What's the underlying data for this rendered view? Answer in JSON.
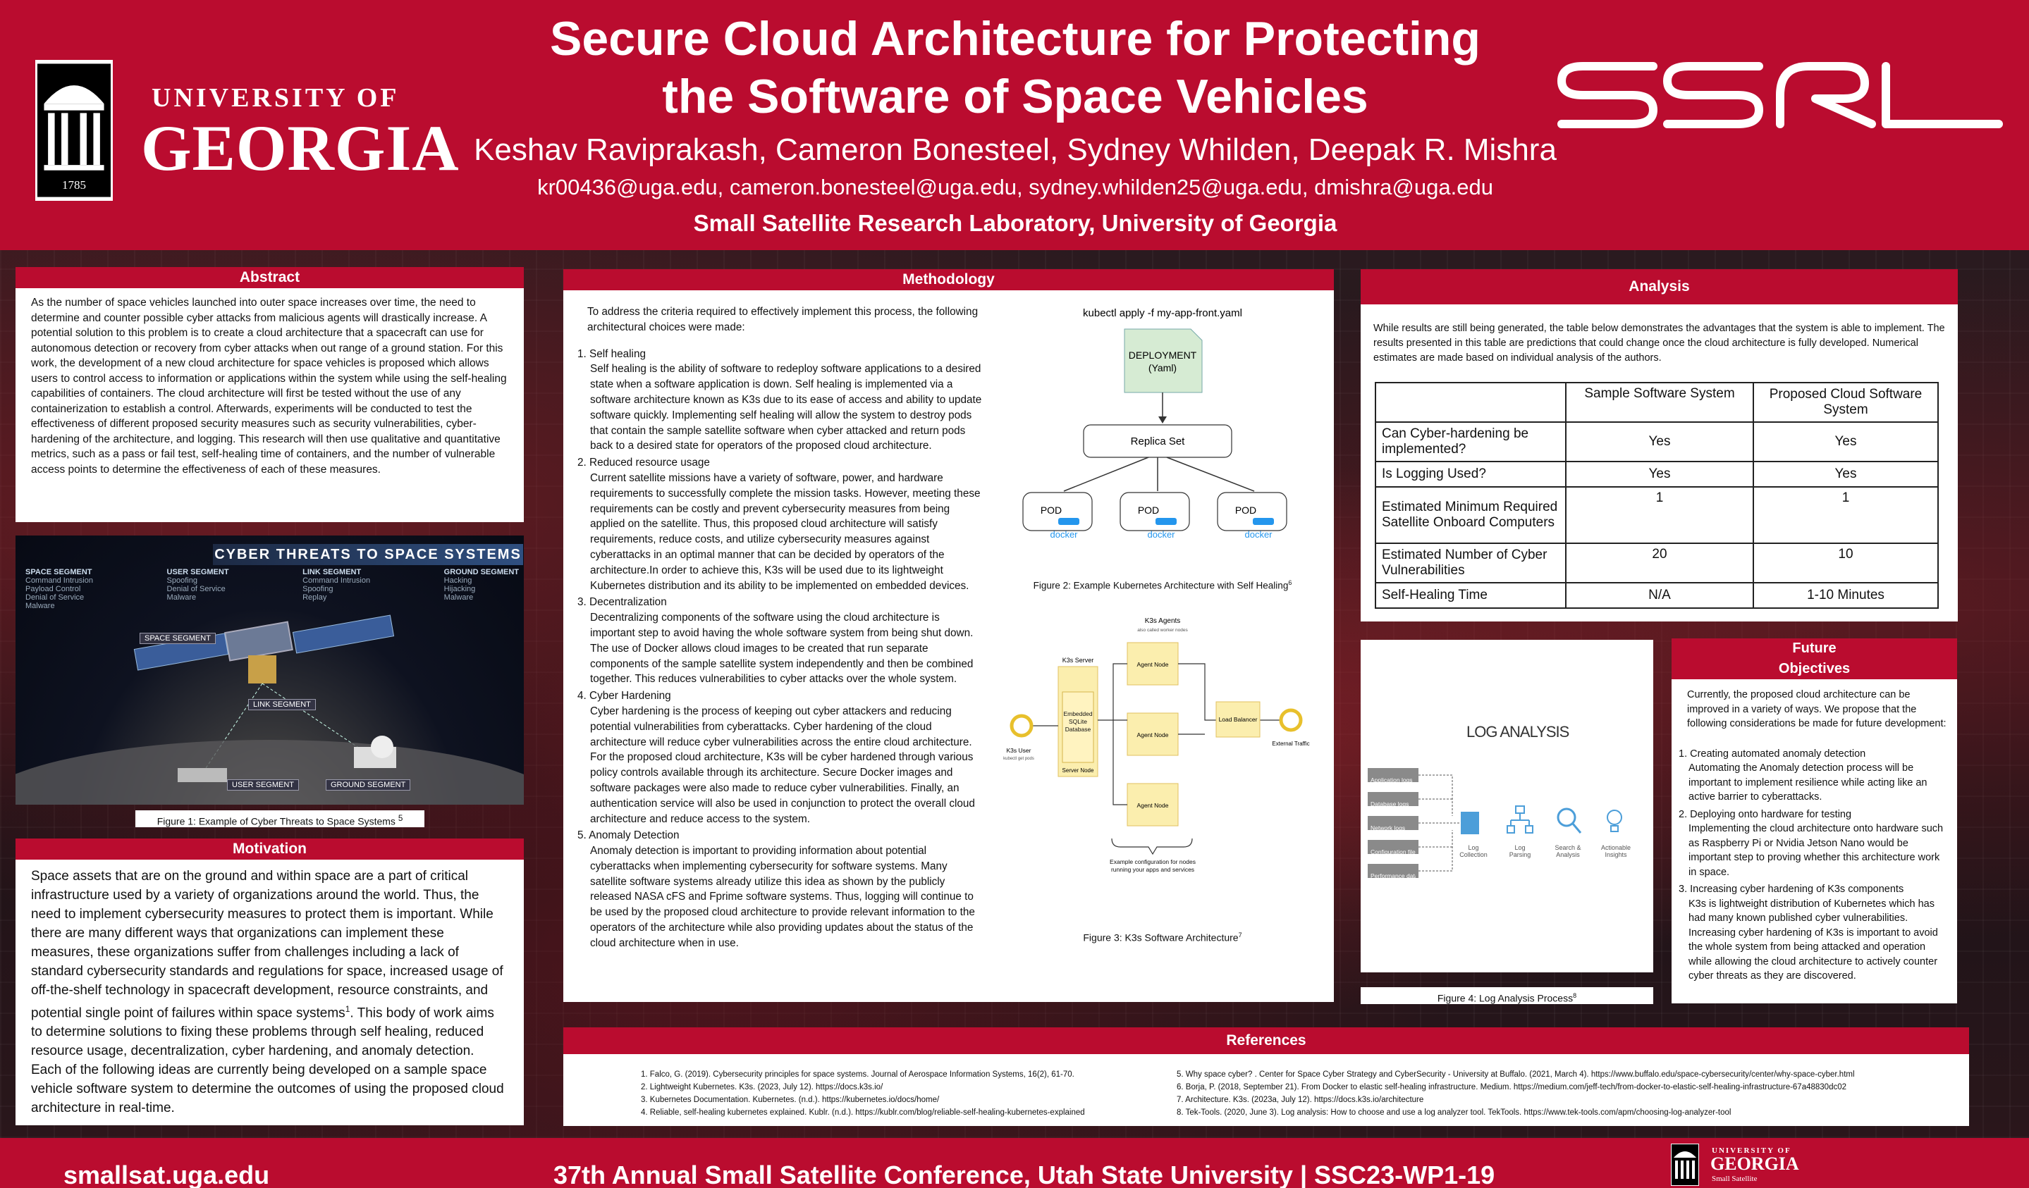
{
  "header": {
    "title_line1": "Secure Cloud Architecture for Protecting",
    "title_line2": "the Software of Space Vehicles",
    "authors": "Keshav Raviprakash, Cameron Bonesteel, Sydney Whilden, Deepak R. Mishra",
    "emails": "kr00436@uga.edu, cameron.bonesteel@uga.edu, sydney.whilden25@uga.edu, dmishra@uga.edu",
    "lab": "Small Satellite Research Laboratory, University of Georgia",
    "uga_line1": "UNIVERSITY OF",
    "uga_line2": "GEORGIA",
    "uga_year": "1785",
    "ssrl_logo": "SSRL"
  },
  "abstract": {
    "title": "Abstract",
    "text": "As the number of space vehicles launched into outer space increases over time, the need to determine and counter possible cyber attacks from malicious agents will drastically increase. A potential solution to this problem is to create a cloud architecture that a spacecraft can use for autonomous detection or recovery from cyber attacks when out range of a ground station. For this work, the development of a new cloud architecture for space vehicles is proposed which allows users to control access to information or applications within the system while using the self-healing capabilities of containers. The cloud architecture will first be tested without the use of any containerization to establish a control. Afterwards, experiments will be conducted to test the effectiveness of different proposed security measures such as security vulnerabilities, cyber-hardening of the architecture, and logging. This research will then use qualitative and quantitative metrics, such as a pass or fail test, self-healing time of containers, and the number of vulnerable access points to determine the effectiveness of each of these measures."
  },
  "figure1": {
    "banner": "CYBER THREATS TO SPACE SYSTEMS",
    "segments": [
      {
        "name": "SPACE SEGMENT",
        "items": [
          "Command Intrusion",
          "Payload Control",
          "Denial of Service",
          "Malware"
        ]
      },
      {
        "name": "USER SEGMENT",
        "items": [
          "Spoofing",
          "Denial of Service",
          "Malware"
        ]
      },
      {
        "name": "LINK SEGMENT",
        "items": [
          "Command Intrusion",
          "Spoofing",
          "Replay"
        ]
      },
      {
        "name": "GROUND SEGMENT",
        "items": [
          "Hacking",
          "Hijacking",
          "Malware"
        ]
      }
    ],
    "labels": {
      "space": "SPACE SEGMENT",
      "link": "LINK SEGMENT",
      "user": "USER SEGMENT",
      "ground": "GROUND SEGMENT"
    },
    "caption": "Figure 1: Example of Cyber Threats to Space Systems",
    "caption_sup": "5"
  },
  "motivation": {
    "title": "Motivation",
    "text_a": "Space assets that are on the ground and within space are a part of critical infrastructure used by a variety of organizations around the world. Thus, the need to implement cybersecurity measures to protect them is important. While there are many different ways that organizations can implement these measures, these organizations suffer from challenges including a lack of standard cybersecurity standards and regulations for space, increased usage of off-the-shelf technology in spacecraft  development, resource constraints, and potential single point of failures within space systems",
    "text_sup": "1",
    "text_b": ". This body of work aims to determine solutions to fixing these problems through self healing, reduced resource usage, decentralization, cyber hardening,  and anomaly detection. Each of the following ideas are currently being developed on a sample space vehicle software system to determine the outcomes of using the proposed cloud architecture in real-time."
  },
  "methodology": {
    "title": "Methodology",
    "intro": "To address the criteria required to effectively implement this process, the following architectural choices were made:",
    "items": [
      {
        "num": "1.",
        "heading": "Self healing",
        "text": "Self healing is the ability of software to redeploy software applications to a desired state when a software application is down. Self healing is implemented via a software architecture known as K3s due to its ease of access and ability to update software quickly. Implementing self healing will allow the system to destroy pods that contain the sample satellite software when cyber attacked and return pods back to a desired state for operators of the proposed cloud architecture."
      },
      {
        "num": "2.",
        "heading": "Reduced resource usage",
        "text": "Current satellite missions have a variety of software, power, and hardware requirements to successfully complete the mission tasks. However, meeting these requirements can be costly and prevent cybersecurity measures from being applied on the satellite. Thus, this proposed cloud architecture will satisfy requirements, reduce costs, and utilize cybersecurity measures against cyberattacks in an optimal manner that can be decided by operators of the architecture.In order to achieve this, K3s will be used due to its lightweight Kubernetes distribution and its ability to be implemented on embedded devices."
      },
      {
        "num": "3.",
        "heading": "Decentralization",
        "text": "Decentralizing components of the software using the cloud architecture is important step to avoid having the whole software system from being shut down. The use of Docker allows cloud images to be created that run separate components of the sample satellite system independently and then be combined together. This reduces vulnerabilities to cyber attacks over the whole system."
      },
      {
        "num": "4.",
        "heading": "Cyber Hardening",
        "text": "Cyber hardening is the process of keeping out cyber attackers and reducing potential vulnerabilities from cyberattacks. Cyber hardening of the cloud architecture will reduce cyber vulnerabilities across the entire cloud architecture. For the proposed cloud architecture, K3s will be cyber hardened through various policy controls available through its architecture. Secure Docker images and software packages were also made to reduce cyber vulnerabilities. Finally, an authentication service will also be used in conjunction to protect the overall cloud architecture and reduce access to the system."
      },
      {
        "num": "5.",
        "heading": "Anomaly Detection",
        "text": "Anomaly detection is important to providing information about potential cyberattacks when implementing cybersecurity for software systems. Many satellite software systems already utilize this idea as shown by the publicly released NASA cFS and Fprime software systems. Thus, logging will continue to be used by the proposed cloud architecture to provide relevant information to the operators of the architecture while also providing updates about the status of the cloud architecture when in use."
      }
    ],
    "fig2": {
      "command": "kubectl apply -f my-app-front.yaml",
      "deployment": "DEPLOYMENT",
      "deployment_sub": "(Yaml)",
      "replica": "Replica Set",
      "pod": "POD",
      "docker": "docker",
      "caption": "Figure 2: Example Kubernetes Architecture with Self Healing",
      "caption_sup": "6"
    },
    "fig3": {
      "agents": "K3s Agents",
      "agents_sub": "also called worker nodes",
      "server": "K3s Server",
      "db": "Embedded SQLite Database",
      "server_node": "Server Node",
      "agent_node": "Agent Node",
      "lb": "Load Balancer",
      "user": "K3s User",
      "user_sub": "kubectl get pods",
      "ext": "External Traffic",
      "note": "Example configuration for nodes running your apps and services",
      "caption": "Figure 3: K3s Software Architecture",
      "caption_sup": "7"
    }
  },
  "analysis": {
    "title": "Analysis",
    "intro": "While results are still being generated, the table below demonstrates the advantages that the system is able to implement. The results presented in this table are predictions that could change once the cloud architecture is fully developed. Numerical estimates are made based on individual analysis of the authors.",
    "headers": [
      "",
      "Sample Software System",
      "Proposed Cloud Software System"
    ],
    "rows": [
      [
        "Can Cyber-hardening be implemented?",
        "Yes",
        "Yes"
      ],
      [
        "Is Logging Used?",
        "Yes",
        "Yes"
      ],
      [
        "Estimated Minimum Required Satellite Onboard Computers",
        "1",
        "1"
      ],
      [
        "Estimated Number of Cyber Vulnerabilities",
        "20",
        "10"
      ],
      [
        "Self-Healing Time",
        "N/A",
        "1-10 Minutes"
      ]
    ]
  },
  "figure4": {
    "title": "LOG ANALYSIS",
    "logs": [
      "Application logs",
      "Database logs",
      "Network logs",
      "Configuration files",
      "Performance data"
    ],
    "steps": [
      "Log Collection",
      "Log Parsing",
      "Search & Analysis",
      "Actionable Insights"
    ],
    "caption": "Figure 4: Log Analysis Process",
    "caption_sup": "8"
  },
  "future": {
    "title_line1": "Future",
    "title_line2": "Objectives",
    "intro": "Currently, the proposed cloud architecture can be improved in a variety of ways. We propose that the following considerations be made for future development:",
    "items": [
      {
        "num": "1.",
        "heading": "Creating automated anomaly detection",
        "text": "Automating the Anomaly detection process will be important to implement resilience while acting like an active barrier to cyberattacks."
      },
      {
        "num": "2.",
        "heading": "Deploying onto hardware for testing",
        "text": "Implementing the cloud architecture onto hardware such as Raspberry Pi or Nvidia Jetson Nano would be important step to proving whether this architecture work in space."
      },
      {
        "num": "3.",
        "heading": "Increasing cyber hardening of K3s components",
        "text": "K3s is lightweight distribution of Kubernetes which has had many known published cyber vulnerabilities. Increasing cyber hardening of K3s is important to avoid the whole system from being attacked and operation while allowing the cloud architecture to actively counter cyber threats as they are discovered."
      }
    ]
  },
  "references": {
    "title": "References",
    "left": [
      "1. Falco, G. (2019). Cybersecurity principles for space systems. Journal of Aerospace Information Systems, 16(2), 61-70.",
      "2. Lightweight Kubernetes. K3s. (2023, July 12). https://docs.k3s.io/",
      "3. Kubernetes Documentation. Kubernetes. (n.d.). https://kubernetes.io/docs/home/",
      "4. Reliable, self-healing kubernetes explained. Kublr. (n.d.). https://kublr.com/blog/reliable-self-healing-kubernetes-explained"
    ],
    "right": [
      "5. Why space cyber? . Center for Space Cyber Strategy and CyberSecurity - University at Buffalo. (2021, March 4). https://www.buffalo.edu/space-cybersecurity/center/why-space-cyber.html",
      "6. Borja, P. (2018, September 21). From Docker to elastic self-healing infrastructure. Medium. https://medium.com/jeff-tech/from-docker-to-elastic-self-healing-infrastructure-67a48830dc02",
      "7. Architecture. K3s. (2023a, July 12). https://docs.k3s.io/architecture",
      "8. Tek-Tools. (2020, June 3). Log analysis: How to choose and use a log analyzer tool. TekTools. https://www.tek-tools.com/apm/choosing-log-analyzer-tool"
    ]
  },
  "footer": {
    "website": "smallsat.uga.edu",
    "conference": "37th Annual Small Satellite Conference, Utah State University | SSC23-WP1-19",
    "logo_line1": "UNIVERSITY OF",
    "logo_line2": "GEORGIA",
    "logo_line3": "Small Satellite"
  },
  "colors": {
    "brand_red": "#ba0c2f",
    "dark_bg": "#1c1115"
  }
}
